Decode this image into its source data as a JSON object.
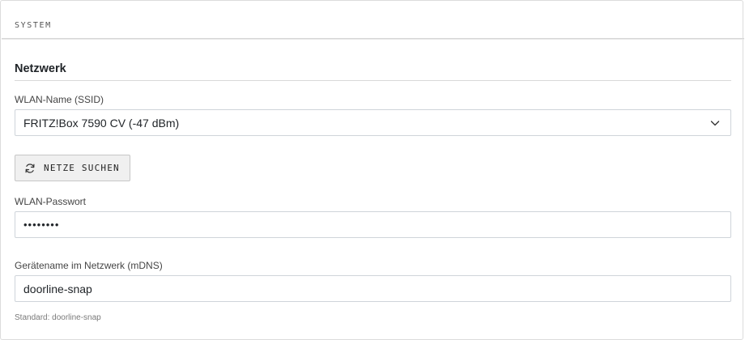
{
  "section": {
    "title": "SYSTEM"
  },
  "network": {
    "title": "Netzwerk",
    "ssid_label": "WLAN-Name (SSID)",
    "ssid_value": "FRITZ!Box 7590 CV (-47 dBm)",
    "scan_button_label": "NETZE SUCHEN",
    "password_label": "WLAN-Passwort",
    "password_value": "••••••••",
    "hostname_label": "Gerätename im Netzwerk (mDNS)",
    "hostname_value": "doorline-snap",
    "hostname_hint": "Standard: doorline-snap"
  },
  "icons": {
    "refresh": "refresh-icon",
    "chevron": "chevron-down-icon"
  }
}
